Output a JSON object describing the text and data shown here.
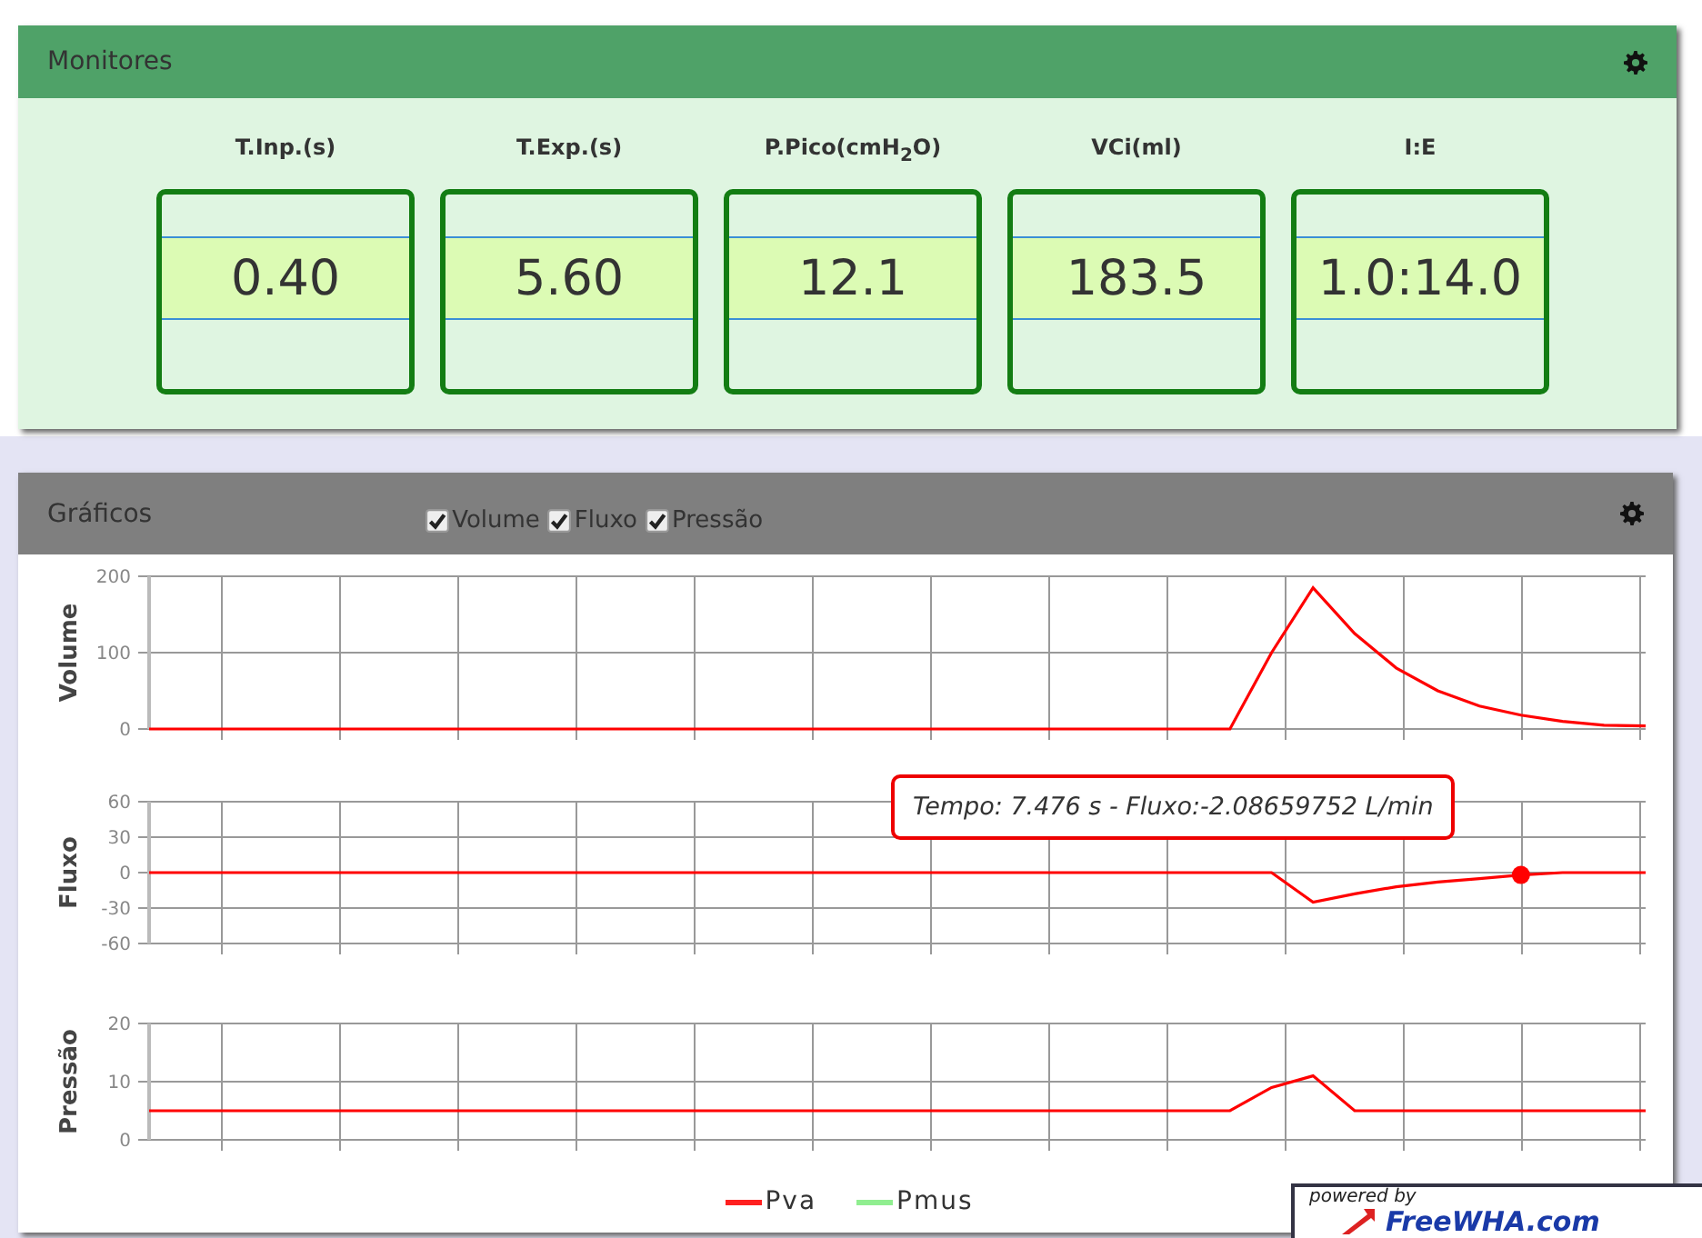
{
  "monitores": {
    "title": "Monitores",
    "metrics": [
      {
        "label": "T.Inp.(s)",
        "value": "0.40"
      },
      {
        "label": "T.Exp.(s)",
        "value": "5.60"
      },
      {
        "label": "P.Pico(cmH$_{2}$O)",
        "value": "12.1"
      },
      {
        "label": "VCi(ml)",
        "value": "183.5"
      },
      {
        "label": "I:E",
        "value": "1.0:14.0"
      }
    ]
  },
  "graficos": {
    "title": "Gráficos",
    "toggles": [
      {
        "label": "Volume",
        "checked": true
      },
      {
        "label": "Fluxo",
        "checked": true
      },
      {
        "label": "Pressão",
        "checked": true
      }
    ],
    "charts": [
      {
        "chart_data": {
          "type": "line",
          "ylabel": "Volume",
          "ylim": [
            0,
            200
          ],
          "yticks": [
            0,
            100,
            200
          ],
          "grid": true,
          "series": [
            {
              "color": "#ff0000",
              "values": [
                0,
                0,
                0,
                0,
                0,
                0,
                0,
                0,
                0,
                0,
                0,
                0,
                0,
                0,
                0,
                0,
                0,
                0,
                0,
                0,
                0,
                0,
                0,
                0,
                0,
                0,
                0,
                100,
                185,
                125,
                80,
                50,
                30,
                18,
                10,
                5,
                4
              ]
            }
          ]
        }
      },
      {
        "chart_data": {
          "type": "line",
          "ylabel": "Fluxo",
          "ylim": [
            -60,
            60
          ],
          "yticks": [
            -60,
            -30,
            0,
            30,
            60
          ],
          "grid": true,
          "series": [
            {
              "color": "#ff0000",
              "values": [
                0,
                0,
                0,
                0,
                0,
                0,
                0,
                0,
                0,
                0,
                0,
                0,
                0,
                0,
                0,
                0,
                0,
                0,
                0,
                0,
                0,
                0,
                0,
                0,
                0,
                0,
                0,
                0,
                -25,
                -18,
                -12,
                -8,
                -5,
                -2,
                0,
                0,
                0
              ]
            }
          ],
          "annotations": [
            "Tempo: 7.476 s - Fluxo:-2.08659752 L/min"
          ]
        }
      },
      {
        "chart_data": {
          "type": "line",
          "ylabel": "Pressão",
          "ylim": [
            0,
            20
          ],
          "yticks": [
            0,
            10,
            20
          ],
          "grid": true,
          "series": [
            {
              "color": "#ff0000",
              "values": [
                5,
                5,
                5,
                5,
                5,
                5,
                5,
                5,
                5,
                5,
                5,
                5,
                5,
                5,
                5,
                5,
                5,
                5,
                5,
                5,
                5,
                5,
                5,
                5,
                5,
                5,
                5,
                9,
                11,
                5,
                5,
                5,
                5,
                5,
                5,
                5,
                5
              ]
            }
          ]
        }
      }
    ],
    "legend": [
      {
        "label": "Pva",
        "color": "#ff2020"
      },
      {
        "label": "Pmus",
        "color": "#90ee90"
      }
    ]
  },
  "badge": {
    "top": "powered by",
    "brand": "FreeWHA.com"
  }
}
